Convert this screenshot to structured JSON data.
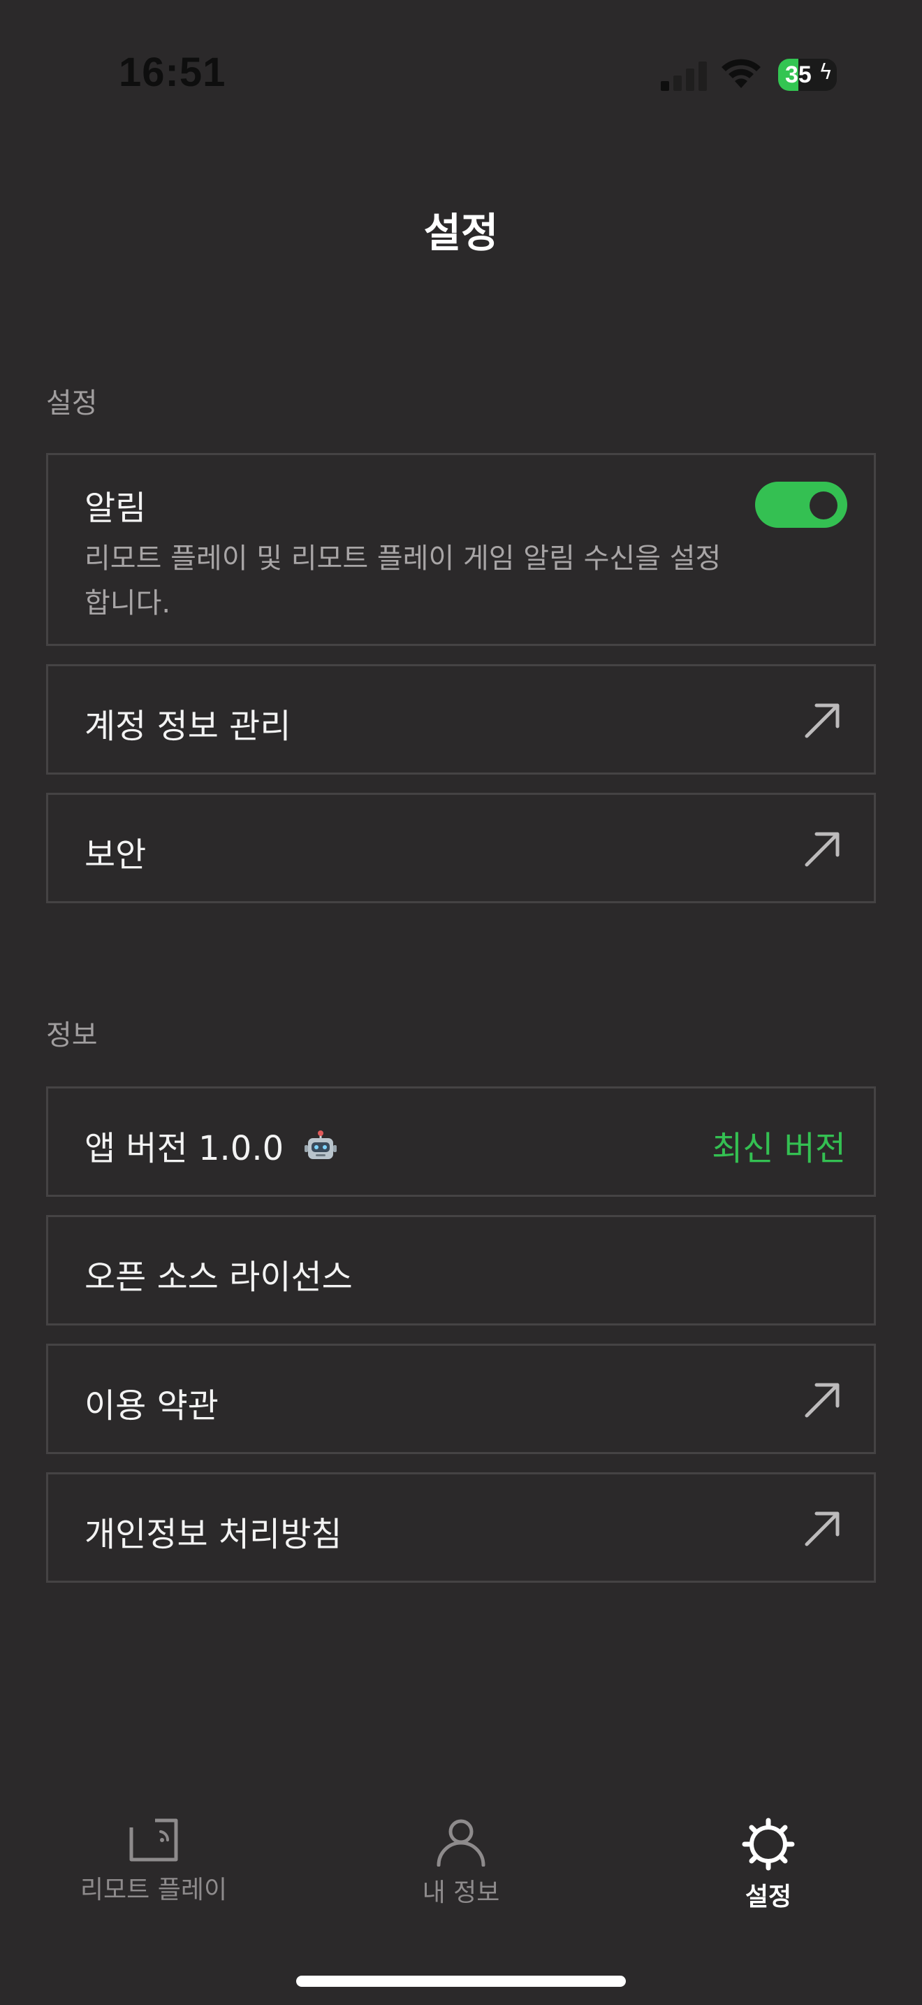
{
  "status_bar": {
    "time": "16:51",
    "battery_level": "35",
    "battery_fraction": 0.35,
    "icons": [
      "signal-icon",
      "wifi-icon",
      "battery-icon",
      "charging-bolt-icon"
    ]
  },
  "header": {
    "title": "설정"
  },
  "sections": {
    "settings": {
      "header": "설정",
      "notifications": {
        "label": "알림",
        "description": "리모트 플레이 및 리모트 플레이 게임 알림 수신을 설정합니다.",
        "enabled": true
      },
      "account": {
        "label": "계정 정보 관리",
        "icon": "external-link-icon"
      },
      "security": {
        "label": "보안",
        "icon": "external-link-icon"
      }
    },
    "info": {
      "header": "정보",
      "version": {
        "label": "앱 버전 1.0.0",
        "emoji": "🤖",
        "status": "최신 버전"
      },
      "licenses": {
        "label": "오픈 소스 라이선스"
      },
      "terms": {
        "label": "이용 약관",
        "icon": "external-link-icon"
      },
      "privacy": {
        "label": "개인정보 처리방침",
        "icon": "external-link-icon"
      }
    }
  },
  "tab_bar": {
    "tabs": [
      {
        "label": "리모트 플레이",
        "icon": "remote-play-icon",
        "active": false
      },
      {
        "label": "내 정보",
        "icon": "person-icon",
        "active": false
      },
      {
        "label": "설정",
        "icon": "gear-icon",
        "active": true
      }
    ]
  },
  "colors": {
    "background": "#2b292a",
    "accent": "#34c052",
    "card_border": "#454344",
    "secondary_text": "#a19e9f"
  }
}
